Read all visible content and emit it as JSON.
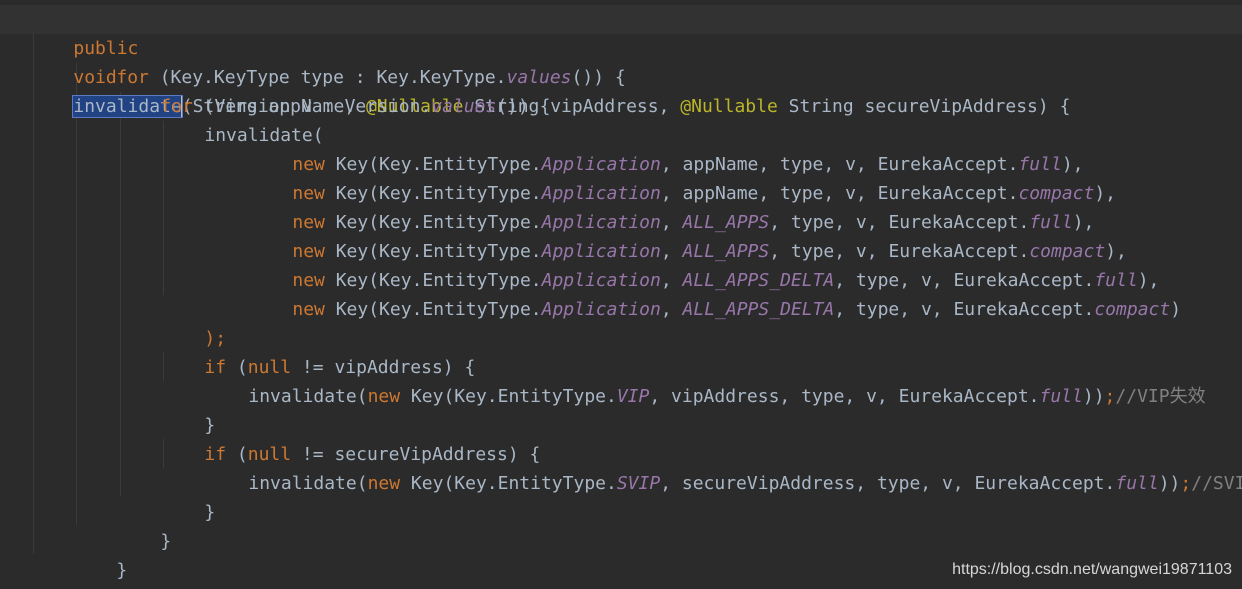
{
  "code": {
    "l01": {
      "kw_public": "public",
      "kw_void": "void",
      "method_name": "invalidate",
      "signature_a": "(String appName, ",
      "ann_1": "@Nullable",
      "signature_b": " String vipAddress, ",
      "ann_2": "@Nullable",
      "signature_c": " String secureVipAddress) {"
    },
    "l02": {
      "kw_for": "for",
      "text": " (Key.KeyType type : Key.KeyType.",
      "method": "values",
      "tail": "()) {"
    },
    "l03": {
      "kw_for": "for",
      "text": " (Version v : Version.",
      "method": "values",
      "tail": "()) {"
    },
    "l04": {
      "text": "invalidate("
    },
    "l05": {
      "kw_new": "new",
      "a": " Key(Key.EntityType.",
      "f1": "Application",
      "b": ", appName, type, v, EurekaAccept.",
      "f2": "full",
      "c": "),"
    },
    "l06": {
      "kw_new": "new",
      "a": " Key(Key.EntityType.",
      "f1": "Application",
      "b": ", appName, type, v, EurekaAccept.",
      "f2": "compact",
      "c": "),"
    },
    "l07": {
      "kw_new": "new",
      "a": " Key(Key.EntityType.",
      "f1": "Application",
      "b": ", ",
      "f_mid": "ALL_APPS",
      "b2": ", type, v, EurekaAccept.",
      "f2": "full",
      "c": "),"
    },
    "l08": {
      "kw_new": "new",
      "a": " Key(Key.EntityType.",
      "f1": "Application",
      "b": ", ",
      "f_mid": "ALL_APPS",
      "b2": ", type, v, EurekaAccept.",
      "f2": "compact",
      "c": "),"
    },
    "l09": {
      "kw_new": "new",
      "a": " Key(Key.EntityType.",
      "f1": "Application",
      "b": ", ",
      "f_mid": "ALL_APPS_DELTA",
      "b2": ", type, v, EurekaAccept.",
      "f2": "full",
      "c": "),"
    },
    "l10": {
      "kw_new": "new",
      "a": " Key(Key.EntityType.",
      "f1": "Application",
      "b": ", ",
      "f_mid": "ALL_APPS_DELTA",
      "b2": ", type, v, EurekaAccept.",
      "f2": "compact",
      "c": ")"
    },
    "l11": {
      "text": ");"
    },
    "l12": {
      "kw_if": "if",
      "a": " (",
      "kw_null": "null",
      "b": " != vipAddress) {"
    },
    "l13": {
      "a": "invalidate(",
      "kw_new": "new",
      "b": " Key(Key.EntityType.",
      "f1": "VIP",
      "c": ", vipAddress, type, v, EurekaAccept.",
      "f2": "full",
      "d": "))",
      "semi": ";",
      "comment": "//VIP失效"
    },
    "l14": {
      "text": "}"
    },
    "l15": {
      "kw_if": "if",
      "a": " (",
      "kw_null": "null",
      "b": " != secureVipAddress) {"
    },
    "l16": {
      "a": "invalidate(",
      "kw_new": "new",
      "b": " Key(Key.EntityType.",
      "f1": "SVIP",
      "c": ", secureVipAddress, type, v, EurekaAccept.",
      "f2": "full",
      "d": "))",
      "semi": ";",
      "comment": "//SVIP失"
    },
    "l17": {
      "text": "}"
    },
    "l18": {
      "text": "}"
    },
    "l19": {
      "text": "}"
    },
    "l20": {
      "text": "}"
    }
  },
  "watermark": "https://blog.csdn.net/wangwei19871103",
  "colors": {
    "background": "#2b2b2b",
    "keyword": "#cc7832",
    "annotation": "#bbb529",
    "field": "#9876aa",
    "comment": "#808080",
    "text": "#a9b7c6",
    "selection": "#214283"
  }
}
